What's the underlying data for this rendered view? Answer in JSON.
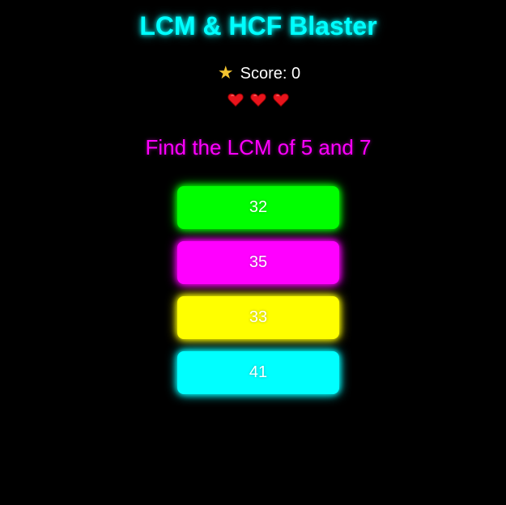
{
  "game": {
    "title": "LCM & HCF Blaster",
    "score_label": "Score: 0",
    "lives_count": 3,
    "question": "Find the LCM of 5 and 7"
  },
  "answers": [
    {
      "label": "32",
      "color": "#00ff00"
    },
    {
      "label": "35",
      "color": "#ff00ff"
    },
    {
      "label": "33",
      "color": "#ffff00"
    },
    {
      "label": "41",
      "color": "#00ffff"
    }
  ],
  "icons": {
    "score": "star-icon",
    "life": "heart-icon"
  }
}
